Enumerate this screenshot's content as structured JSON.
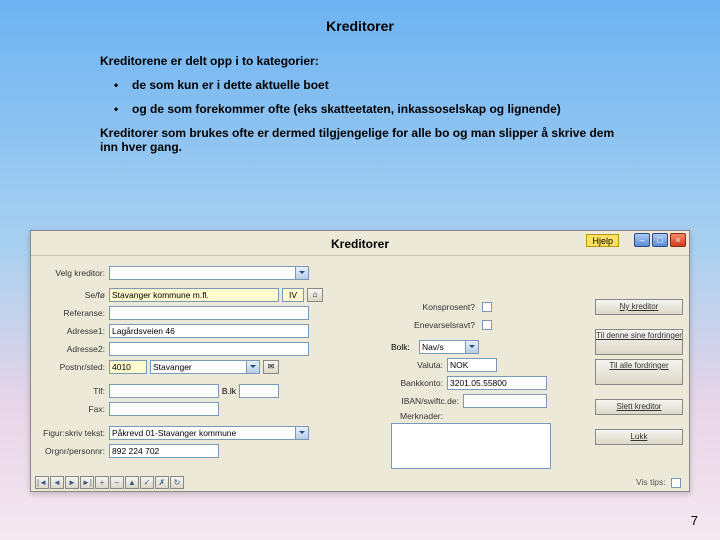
{
  "slide": {
    "title": "Kreditorer",
    "intro_line": "Kreditorene er delt opp i to kategorier:",
    "bullet1": "de som kun er i dette aktuelle boet",
    "bullet2": "og de som forekommer ofte (eks skatteetaten, inkassoselskap og lignende)",
    "closing": "Kreditorer som brukes ofte er dermed tilgjengelige for alle bo og man slipper å skrive dem inn hver gang.",
    "page_num": "7"
  },
  "win": {
    "title": "Kreditorer",
    "badge": "Hjelp",
    "velg_label": "Velg kreditor:",
    "velg_value": "",
    "labels": {
      "selfo": "Se/fø",
      "referanse": "Referanse:",
      "adresse1": "Adresse1:",
      "adresse2": "Adresse2:",
      "postnr": "Postnr/sted:",
      "tlf": "Tlf:",
      "fax": "Fax:",
      "figur": "Figur:skriv tekst:",
      "orgnr": "Orgnr/personnr:",
      "konspros": "Konsprosent?",
      "enevarsel": "Enevarselsravt?",
      "valuta": "Valuta:",
      "bankkonto": "Bankkonto:",
      "iban": "IBAN/swiftc.de:",
      "merknader": "Merknader:",
      "bolk_label": "B.lk"
    },
    "values": {
      "selfo": "Stavanger kommune m.fl.",
      "selfo_code": "IV",
      "adresse1": "Lagårdsveien 46",
      "postnr": "4010",
      "postby": "Stavanger",
      "bolk": "Nav/s",
      "valuta": "NOK",
      "bankkonto": "3201.05.55800",
      "figur": "Påkrevd 01-Stavanger kommune",
      "orgnr": "892 224 702"
    },
    "buttons": {
      "ny": "Ny kreditor",
      "tildenne": "Til denne sine fordringer",
      "tilalle": "Til alle fordringer",
      "slett": "Slett kreditor",
      "lukk": "Lukk"
    },
    "status_tip": "Vis tips:",
    "nav": [
      "|◄",
      "◄",
      "►",
      "►|",
      "+",
      "–",
      "▲",
      "✓",
      "✗",
      "↻"
    ]
  }
}
